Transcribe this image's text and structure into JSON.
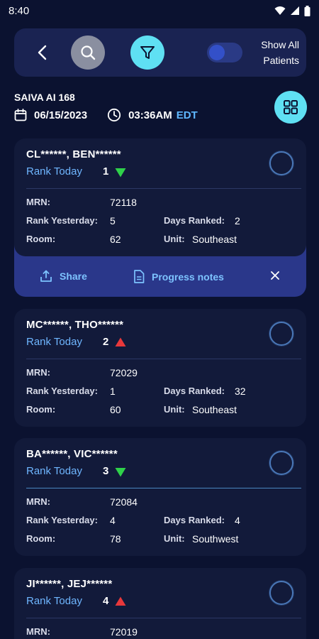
{
  "status_bar": {
    "time": "8:40"
  },
  "toolbar": {
    "toggle_label_line1": "Show All",
    "toggle_label_line2": "Patients"
  },
  "header": {
    "facility": "SAIVA AI 168",
    "date": "06/15/2023",
    "time": "03:36AM",
    "timezone": "EDT"
  },
  "labels": {
    "rank_today": "Rank Today",
    "mrn": "MRN:",
    "rank_yesterday": "Rank Yesterday:",
    "room": "Room:",
    "days_ranked": "Days Ranked:",
    "unit": "Unit:"
  },
  "actions": {
    "share": "Share",
    "progress_notes": "Progress notes"
  },
  "colors": {
    "background": "#0b1230",
    "card": "#121a3a",
    "accent_cyan": "#5fe0f3",
    "accent_blue": "#6fb6ff",
    "down_green": "#2fd14a",
    "up_red": "#e8383b",
    "action_bar": "#2a378a"
  },
  "patients": [
    {
      "name": "CL******, BEN******",
      "rank_today": "1",
      "trend": "down",
      "mrn": "72118",
      "rank_yesterday": "5",
      "room": "62",
      "days_ranked": "2",
      "unit": "Southeast"
    },
    {
      "name": "MC******, THO******",
      "rank_today": "2",
      "trend": "up",
      "mrn": "72029",
      "rank_yesterday": "1",
      "room": "60",
      "days_ranked": "32",
      "unit": "Southeast"
    },
    {
      "name": "BA******, VIC******",
      "rank_today": "3",
      "trend": "down",
      "mrn": "72084",
      "rank_yesterday": "4",
      "room": "78",
      "days_ranked": "4",
      "unit": "Southwest"
    },
    {
      "name": "JI******, JEJ******",
      "rank_today": "4",
      "trend": "up",
      "mrn": "72019"
    }
  ]
}
